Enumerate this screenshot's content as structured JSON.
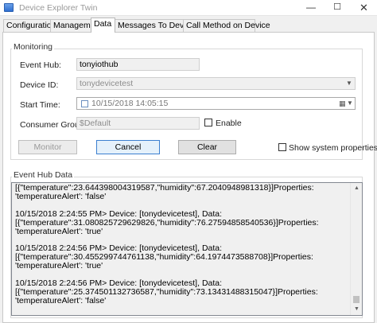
{
  "window": {
    "title": "Device Explorer Twin",
    "minimize": "—",
    "maximize": "☐",
    "close": "✕"
  },
  "tabs": [
    "Configuration",
    "Management",
    "Data",
    "Messages To Device",
    "Call Method on Device"
  ],
  "active_tab": "Data",
  "monitoring": {
    "group_label": "Monitoring",
    "event_hub_label": "Event Hub:",
    "event_hub_value": "tonyiothub",
    "device_id_label": "Device ID:",
    "device_id_value": "tonydevicetest",
    "start_time_label": "Start Time:",
    "start_time_value": "10/15/2018 14:05:15",
    "consumer_group_label": "Consumer Group:",
    "consumer_group_value": "$Default",
    "enable_label": "Enable",
    "monitor_button": "Monitor",
    "cancel_button": "Cancel",
    "clear_button": "Clear",
    "show_props_label": "Show system properties"
  },
  "event_hub_data": {
    "group_label": "Event Hub Data",
    "lines": [
      "[{\"temperature\":23.644398004319587,\"humidity\":67.2040948981318}]Properties:",
      "'temperatureAlert': 'false'",
      "",
      "10/15/2018 2:24:55 PM> Device: [tonydevicetest], Data:",
      "[{\"temperature\":31.080825729629826,\"humidity\":76.27594858540536}]Properties:",
      "'temperatureAlert': 'true'",
      "",
      "10/15/2018 2:24:56 PM> Device: [tonydevicetest], Data:",
      "[{\"temperature\":30.455299744761138,\"humidity\":64.1974473588708}]Properties:",
      "'temperatureAlert': 'true'",
      "",
      "10/15/2018 2:24:56 PM> Device: [tonydevicetest], Data:",
      "[{\"temperature\":25.374501132736587,\"humidity\":73.13431488315047}]Properties:",
      "'temperatureAlert': 'false'"
    ],
    "scroll_up": "▲",
    "scroll_down": "▼"
  }
}
